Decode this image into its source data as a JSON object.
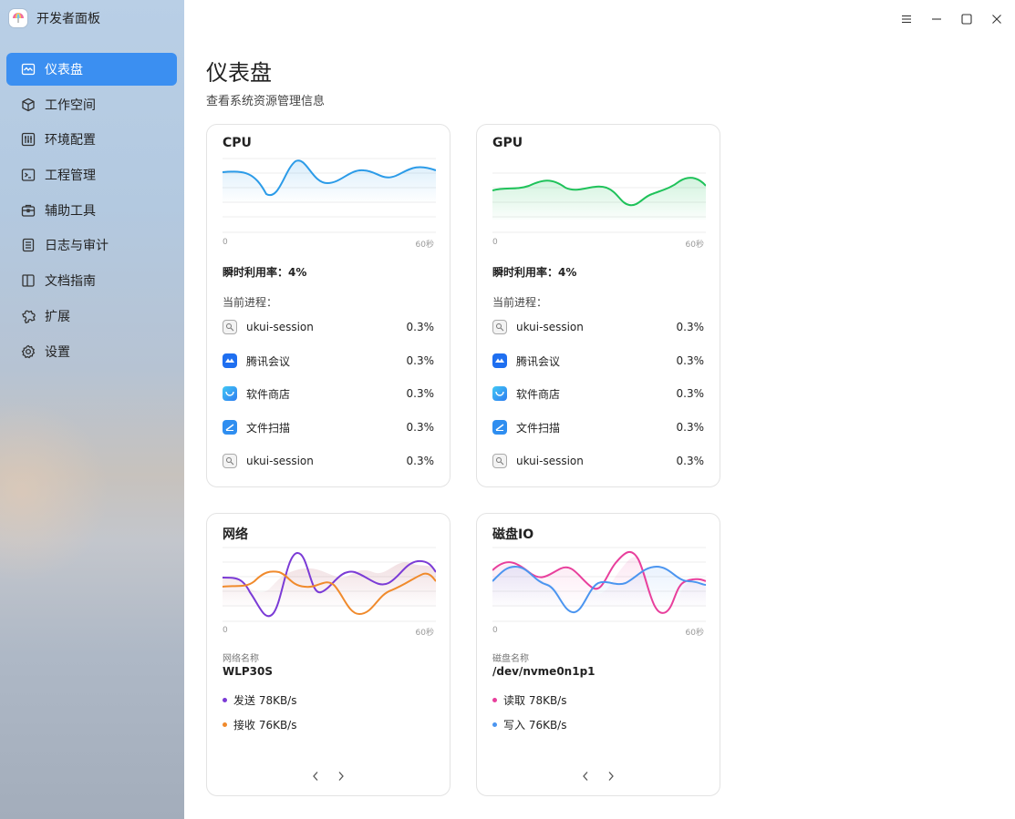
{
  "app": {
    "title": "开发者面板"
  },
  "nav": {
    "items": [
      {
        "label": "仪表盘",
        "icon": "dashboard-icon",
        "active": true
      },
      {
        "label": "工作空间",
        "icon": "cube-icon"
      },
      {
        "label": "环境配置",
        "icon": "sliders-icon"
      },
      {
        "label": "工程管理",
        "icon": "terminal-icon"
      },
      {
        "label": "辅助工具",
        "icon": "toolbox-icon"
      },
      {
        "label": "日志与审计",
        "icon": "log-icon"
      },
      {
        "label": "文档指南",
        "icon": "docs-icon"
      },
      {
        "label": "扩展",
        "icon": "puzzle-icon"
      },
      {
        "label": "设置",
        "icon": "gear-icon"
      }
    ]
  },
  "window": {
    "controls": [
      "menu-icon",
      "minimize-icon",
      "maximize-icon",
      "close-icon"
    ]
  },
  "page": {
    "title": "仪表盘",
    "subtitle": "查看系统资源管理信息"
  },
  "cpu": {
    "title": "CPU",
    "x_start": "0",
    "x_end": "60秒",
    "utilization": "瞬时利用率：4%",
    "process_label": "当前进程：",
    "color": "#2b9be8",
    "processes": [
      {
        "name": "ukui-session",
        "value": "0.3%",
        "icon": "ukui-session-icon"
      },
      {
        "name": "腾讯会议",
        "value": "0.3%",
        "icon": "tencent-meeting-icon"
      },
      {
        "name": "软件商店",
        "value": "0.3%",
        "icon": "software-store-icon"
      },
      {
        "name": "文件扫描",
        "value": "0.3%",
        "icon": "file-scan-icon"
      },
      {
        "name": "ukui-session",
        "value": "0.3%",
        "icon": "ukui-session-icon"
      }
    ]
  },
  "gpu": {
    "title": "GPU",
    "x_start": "0",
    "x_end": "60秒",
    "utilization": "瞬时利用率：4%",
    "process_label": "当前进程：",
    "color": "#1fc25a",
    "processes": [
      {
        "name": "ukui-session",
        "value": "0.3%",
        "icon": "ukui-session-icon"
      },
      {
        "name": "腾讯会议",
        "value": "0.3%",
        "icon": "tencent-meeting-icon"
      },
      {
        "name": "软件商店",
        "value": "0.3%",
        "icon": "software-store-icon"
      },
      {
        "name": "文件扫描",
        "value": "0.3%",
        "icon": "file-scan-icon"
      },
      {
        "name": "ukui-session",
        "value": "0.3%",
        "icon": "ukui-session-icon"
      }
    ]
  },
  "network": {
    "title": "网络",
    "x_start": "0",
    "x_end": "60秒",
    "name_label": "网络名称",
    "name_value": "WLP30S",
    "send": "发送 78KB/s",
    "receive": "接收 76KB/s",
    "send_color": "#7b3bd6",
    "receive_color": "#f08a2c"
  },
  "disk": {
    "title": "磁盘IO",
    "x_start": "0",
    "x_end": "60秒",
    "name_label": "磁盘名称",
    "name_value": "/dev/nvme0n1p1",
    "read": "读取 78KB/s",
    "write": "写入 76KB/s",
    "read_color": "#e83f9c",
    "write_color": "#4b95f0"
  }
}
